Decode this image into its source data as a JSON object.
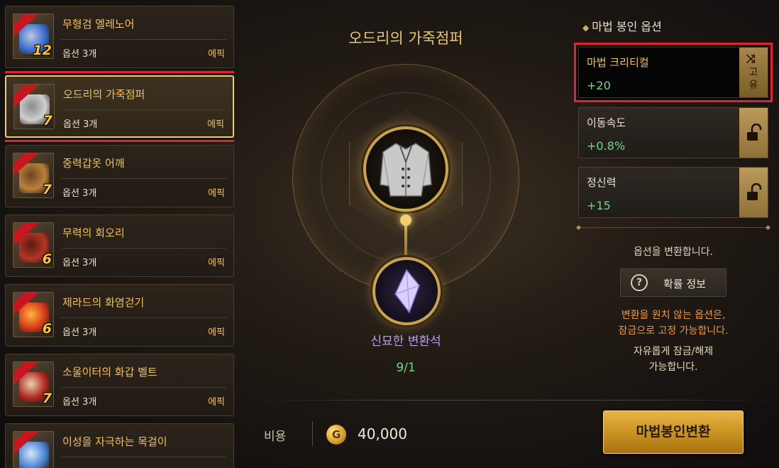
{
  "items": [
    {
      "name": "무형검 엘레노어",
      "options": "옵션 3개",
      "grade": "에픽",
      "level": "12",
      "selected": false,
      "art": "sword"
    },
    {
      "name": "오드리의 가죽점퍼",
      "options": "옵션 3개",
      "grade": "에픽",
      "level": "7",
      "selected": true,
      "art": "jacket"
    },
    {
      "name": "중력갑옷 어깨",
      "options": "옵션 3개",
      "grade": "에픽",
      "level": "7",
      "selected": false,
      "art": "shoulder"
    },
    {
      "name": "무력의 회오리",
      "options": "옵션 3개",
      "grade": "에픽",
      "level": "6",
      "selected": false,
      "art": "armor"
    },
    {
      "name": "제라드의 화염걷기",
      "options": "옵션 3개",
      "grade": "에픽",
      "level": "6",
      "selected": false,
      "art": "boots"
    },
    {
      "name": "소울이터의 화갑 벨트",
      "options": "옵션 3개",
      "grade": "에픽",
      "level": "7",
      "selected": false,
      "art": "belt"
    },
    {
      "name": "이성을 자극하는 목걸이",
      "options": "",
      "grade": "",
      "level": "",
      "selected": false,
      "art": "necklace"
    }
  ],
  "center": {
    "title": "오드리의 가죽점퍼",
    "stone_name": "신묘한 변환석",
    "stone_count": "9/1"
  },
  "cost": {
    "label": "비용",
    "currency_icon": "G",
    "value": "40,000"
  },
  "action_button": "마법봉인변환",
  "panel": {
    "title": "마법 봉인 옵션",
    "options": [
      {
        "name": "마법 크리티컬",
        "value": "+20",
        "fixed": true,
        "fixed_label": "고유",
        "fixed_icon": "⤨"
      },
      {
        "name": "이동속도",
        "value": "+0.8%",
        "fixed": false
      },
      {
        "name": "정신력",
        "value": "+15",
        "fixed": false
      }
    ],
    "convert_text": "옵션을 변환합니다.",
    "prob_button": "확률 정보",
    "note_line1": "변환을 원치 않는 옵션은,",
    "note_line2": "잠금으로 고정 가능합니다.",
    "note_line3": "자유롭게 잠금/해제",
    "note_line4": "가능합니다."
  },
  "colors": {
    "accent_gold": "#f0c25a",
    "value_green": "#6fd58a",
    "stone_purple": "#b79cf0",
    "highlight_red": "#e02330"
  }
}
